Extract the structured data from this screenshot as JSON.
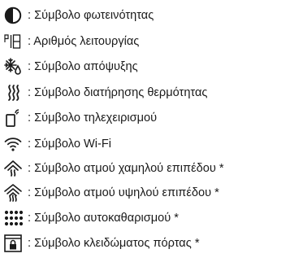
{
  "symbols": [
    {
      "icon": "brightness-icon",
      "label": ": Σύμβολο φωτεινότητας"
    },
    {
      "icon": "program-number-icon",
      "label": ": Αριθμός λειτουργίας"
    },
    {
      "icon": "defrost-icon",
      "label": ": Σύμβολο απόψυξης"
    },
    {
      "icon": "keep-warm-icon",
      "label": ": Σύμβολο διατήρησης θερμότητας"
    },
    {
      "icon": "remote-control-icon",
      "label": ": Σύμβολο τηλεχειρισμού"
    },
    {
      "icon": "wifi-icon",
      "label": ": Σύμβολο Wi-Fi"
    },
    {
      "icon": "steam-low-icon",
      "label": ": Σύμβολο ατμού χαμηλού επιπέδου *"
    },
    {
      "icon": "steam-high-icon",
      "label": ": Σύμβολο ατμού υψηλού επιπέδου *"
    },
    {
      "icon": "self-cleaning-icon",
      "label": ": Σύμβολο αυτοκαθαρισμού *"
    },
    {
      "icon": "door-lock-icon",
      "label": ": Σύμβολο κλειδώματος πόρτας *"
    }
  ],
  "colors": {
    "text": "#1a1a1a",
    "icon": "#1a1a1a",
    "background": "#ffffff"
  }
}
